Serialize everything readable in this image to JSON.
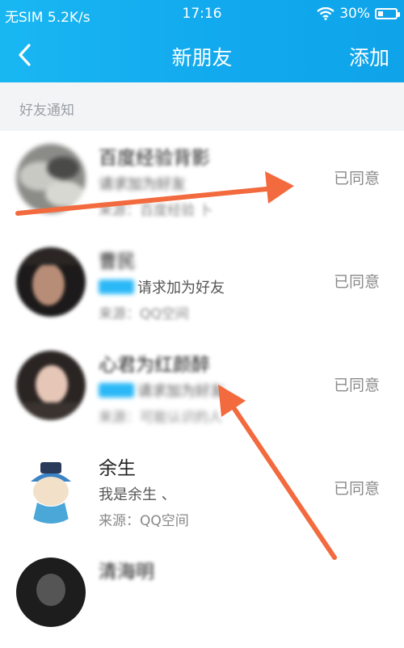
{
  "status_bar": {
    "carrier": "无SIM 5.2K/s",
    "time": "17:16",
    "battery": "30%"
  },
  "nav": {
    "title": "新朋友",
    "add_label": "添加"
  },
  "section": {
    "label": "好友通知"
  },
  "rows": [
    {
      "name": "百度经验背影",
      "sub": "请求加为好友",
      "source": "来源：百度经验 卜",
      "status": "已同意"
    },
    {
      "name": "曹民",
      "sub": "请求加为好友",
      "source": "来源：QQ空间",
      "status": "已同意"
    },
    {
      "name": "心君为红颜醉",
      "sub": "请求加为好友",
      "source": "来源：可能认识的人",
      "status": "已同意"
    },
    {
      "name": "余生",
      "sub": "我是余生  、",
      "source": "来源：QQ空间",
      "status": "已同意"
    },
    {
      "name": "清海明",
      "sub": "",
      "source": "",
      "status": ""
    }
  ],
  "colors": {
    "accent": "#12a9ee",
    "annotation": "#f26a3d",
    "tag": "#2bb8f6"
  }
}
